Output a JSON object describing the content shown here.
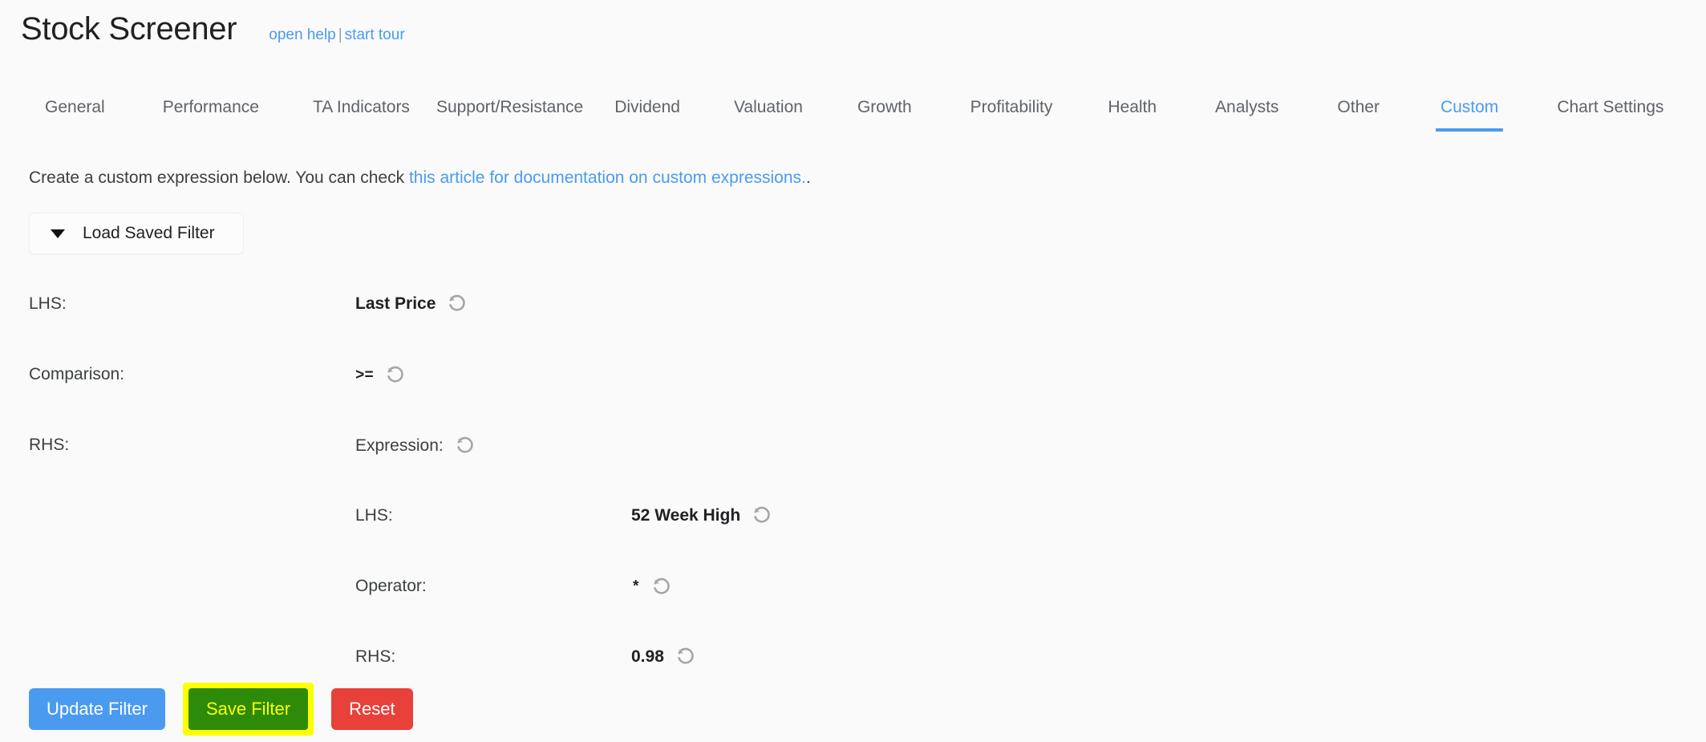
{
  "header": {
    "title": "Stock Screener",
    "open_help": "open help",
    "separator": "|",
    "start_tour": "start tour"
  },
  "tabs": [
    {
      "label": "General",
      "active": false
    },
    {
      "label": "Performance",
      "active": false
    },
    {
      "label": "TA Indicators",
      "active": false
    },
    {
      "label": "Support/Resistance",
      "active": false
    },
    {
      "label": "Dividend",
      "active": false
    },
    {
      "label": "Valuation",
      "active": false
    },
    {
      "label": "Growth",
      "active": false
    },
    {
      "label": "Profitability",
      "active": false
    },
    {
      "label": "Health",
      "active": false
    },
    {
      "label": "Analysts",
      "active": false
    },
    {
      "label": "Other",
      "active": false
    },
    {
      "label": "Custom",
      "active": true
    },
    {
      "label": "Chart Settings",
      "active": false
    }
  ],
  "description": {
    "prefix": "Create a custom expression below. You can check ",
    "link_text": "this article for documentation on custom expressions.",
    "suffix": "."
  },
  "load_saved_filter": {
    "label": "Load Saved Filter",
    "caret": "chevron-down-icon"
  },
  "form": {
    "lhs": {
      "label": "LHS:",
      "value": "Last Price",
      "reset": "reset-icon"
    },
    "comparison": {
      "label": "Comparison:",
      "value": ">=",
      "reset": "reset-icon"
    },
    "rhs": {
      "label": "RHS:",
      "expression_label": "Expression:",
      "reset": "reset-icon",
      "nested": {
        "lhs": {
          "label": "LHS:",
          "value": "52 Week High",
          "reset": "reset-icon"
        },
        "operator": {
          "label": "Operator:",
          "value": "*",
          "reset": "reset-icon"
        },
        "rhs": {
          "label": "RHS:",
          "value": "0.98",
          "reset": "reset-icon"
        }
      }
    }
  },
  "buttons": {
    "update_filter": "Update Filter",
    "save_filter": "Save Filter",
    "reset": "Reset"
  },
  "colors": {
    "accent_blue": "#4a9bf0",
    "button_blue": "#4a9bf0",
    "button_green": "#2e8b09",
    "button_red": "#e8413a",
    "highlight_yellow": "#fbff00",
    "page_background": "#fafafa",
    "reset_icon_gray": "#a6a6a6"
  }
}
